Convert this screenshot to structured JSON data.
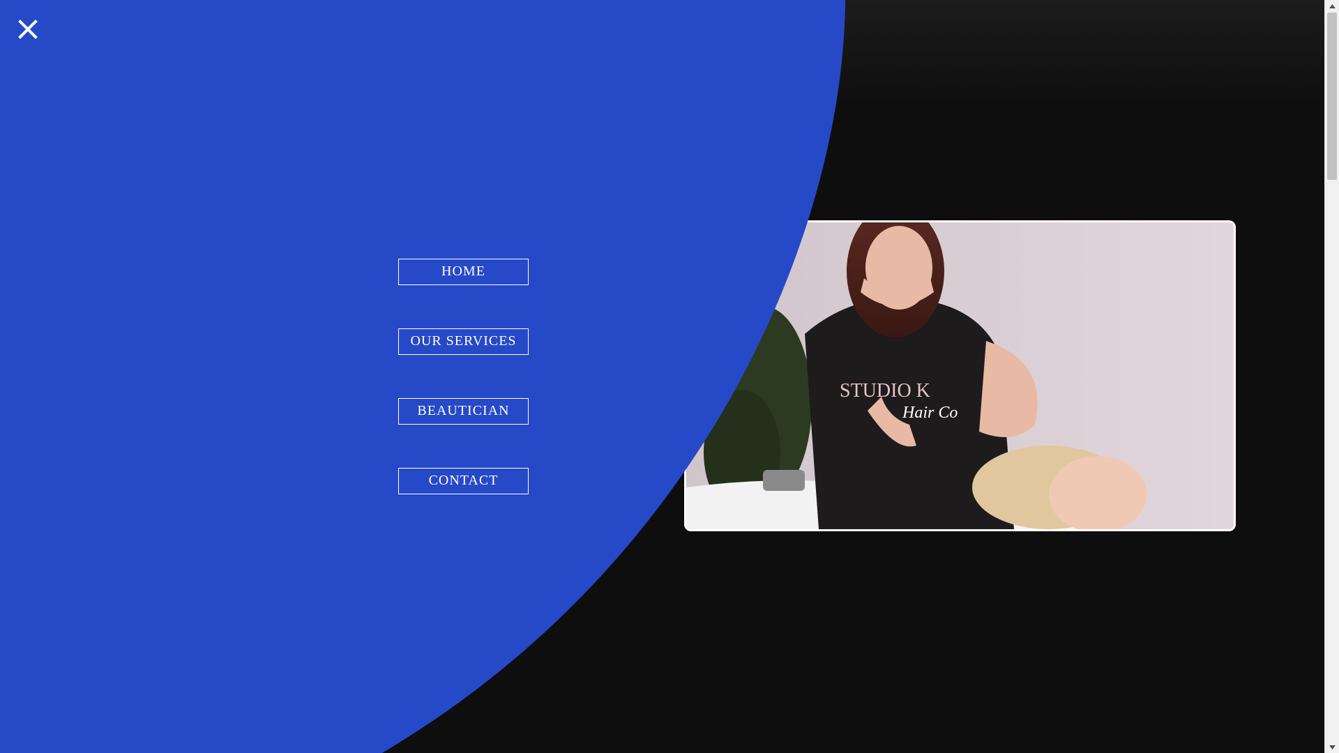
{
  "window": {
    "close_icon": "close-icon"
  },
  "nav": {
    "items": [
      {
        "label": "HOME"
      },
      {
        "label": "OUR SERVICES"
      },
      {
        "label": "BEAUTICIAN"
      },
      {
        "label": "CONTACT"
      }
    ]
  },
  "media": {
    "shirt_text_line1": "STUDIO K",
    "shirt_text_line2": "Hair Co"
  },
  "colors": {
    "overlay_blue": "#2649c8",
    "background": "#0e0e0e",
    "nav_border": "#ffffff"
  }
}
